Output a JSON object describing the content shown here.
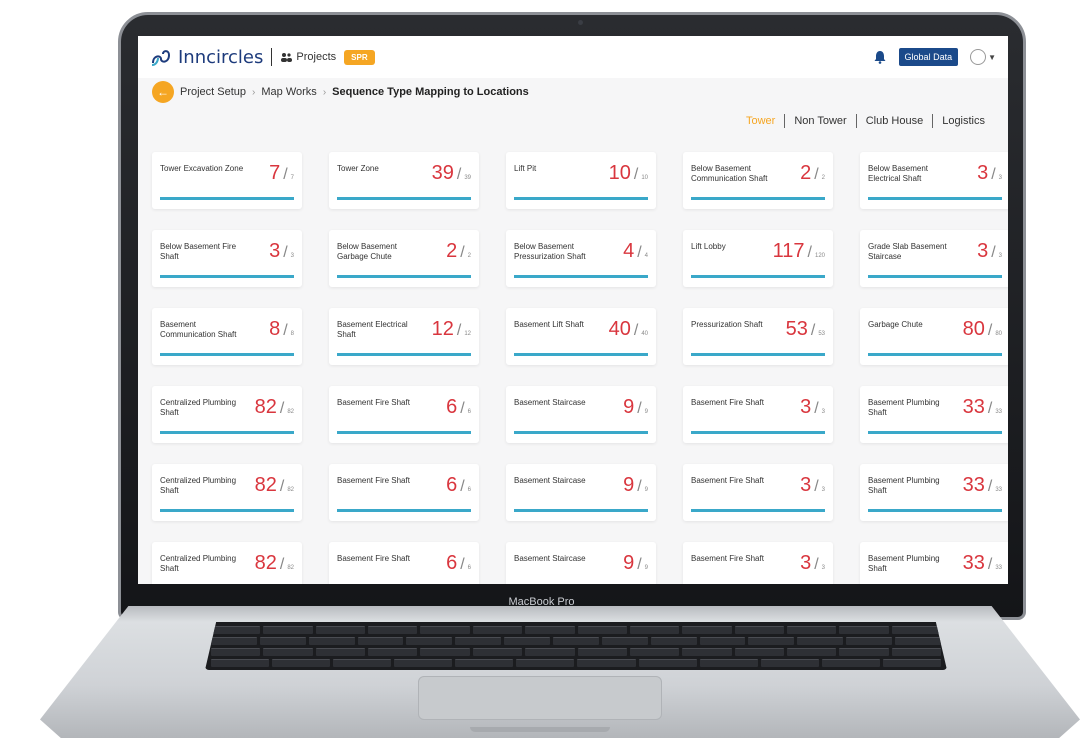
{
  "device": {
    "bezel_label": "MacBook Pro"
  },
  "app": {
    "logo_text": "Inncircles",
    "projects_label": "Projects",
    "project_badge": "SPR",
    "global_data_label": "Global Data"
  },
  "breadcrumb": {
    "items": [
      "Project Setup",
      "Map Works",
      "Sequence Type Mapping to Locations"
    ]
  },
  "tabs": [
    "Tower",
    "Non Tower",
    "Club House",
    "Logistics"
  ],
  "active_tab": "Tower",
  "colors": {
    "accent": "#f5a623",
    "brand": "#1b4a8a",
    "value": "#d9363e",
    "bar": "#3aa8c9"
  },
  "cards": [
    {
      "label": "Tower Excavation Zone",
      "value": "7",
      "total": "7"
    },
    {
      "label": "Tower Zone",
      "value": "39",
      "total": "39"
    },
    {
      "label": "Lift Pit",
      "value": "10",
      "total": "10"
    },
    {
      "label": "Below Basement Communication Shaft",
      "value": "2",
      "total": "2"
    },
    {
      "label": "Below Basement Electrical Shaft",
      "value": "3",
      "total": "3"
    },
    {
      "label": "Below Basement Fire Shaft",
      "value": "3",
      "total": "3"
    },
    {
      "label": "Below Basement Garbage Chute",
      "value": "2",
      "total": "2"
    },
    {
      "label": "Below Basement Pressurization Shaft",
      "value": "4",
      "total": "4"
    },
    {
      "label": "Lift Lobby",
      "value": "117",
      "total": "120"
    },
    {
      "label": "Grade Slab Basement Staircase",
      "value": "3",
      "total": "3"
    },
    {
      "label": "Basement Communication Shaft",
      "value": "8",
      "total": "8"
    },
    {
      "label": "Basement Electrical Shaft",
      "value": "12",
      "total": "12"
    },
    {
      "label": "Basement Lift Shaft",
      "value": "40",
      "total": "40"
    },
    {
      "label": "Pressurization Shaft",
      "value": "53",
      "total": "53"
    },
    {
      "label": "Garbage Chute",
      "value": "80",
      "total": "80"
    },
    {
      "label": "Centralized Plumbing Shaft",
      "value": "82",
      "total": "82"
    },
    {
      "label": "Basement Fire Shaft",
      "value": "6",
      "total": "6"
    },
    {
      "label": "Basement Staircase",
      "value": "9",
      "total": "9"
    },
    {
      "label": "Basement Fire Shaft",
      "value": "3",
      "total": "3"
    },
    {
      "label": "Basement Plumbing Shaft",
      "value": "33",
      "total": "33"
    },
    {
      "label": "Centralized Plumbing Shaft",
      "value": "82",
      "total": "82"
    },
    {
      "label": "Basement Fire Shaft",
      "value": "6",
      "total": "6"
    },
    {
      "label": "Basement Staircase",
      "value": "9",
      "total": "9"
    },
    {
      "label": "Basement Fire Shaft",
      "value": "3",
      "total": "3"
    },
    {
      "label": "Basement Plumbing Shaft",
      "value": "33",
      "total": "33"
    },
    {
      "label": "Centralized Plumbing Shaft",
      "value": "82",
      "total": "82"
    },
    {
      "label": "Basement Fire Shaft",
      "value": "6",
      "total": "6"
    },
    {
      "label": "Basement Staircase",
      "value": "9",
      "total": "9"
    },
    {
      "label": "Basement Fire Shaft",
      "value": "3",
      "total": "3"
    },
    {
      "label": "Basement Plumbing Shaft",
      "value": "33",
      "total": "33"
    }
  ]
}
